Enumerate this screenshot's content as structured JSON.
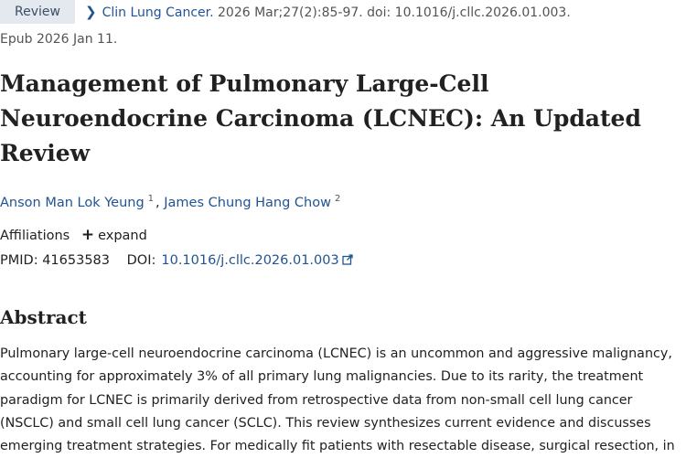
{
  "header": {
    "type_badge": "Review",
    "journal": "Clin Lung Cancer.",
    "citation": "2026 Mar;27(2):85-97. doi: 10.1016/j.cllc.2026.01.003.",
    "epub": "Epub 2026 Jan 11."
  },
  "article": {
    "title_lines": [
      "Management of Pulmonary Large-Cell",
      "Neuroendocrine Carcinoma (LCNEC): An Updated",
      "Review"
    ],
    "authors": [
      {
        "name": "Anson Man Lok Yeung",
        "sup": "1"
      },
      {
        "name": "James Chung Hang Chow",
        "sup": "2"
      }
    ],
    "author_separator": ",",
    "affiliations_label": "Affiliations",
    "expand_label": "expand",
    "pmid_label": "PMID:",
    "pmid": "41653583",
    "doi_label": "DOI:",
    "doi": "10.1016/j.cllc.2026.01.003"
  },
  "abstract": {
    "heading": "Abstract",
    "lines": [
      "Pulmonary large-cell neuroendocrine carcinoma (LCNEC) is an uncommon and aggressive malignancy,",
      "accounting for approximately 3% of all primary lung malignancies. Due to its rarity, the treatment",
      "paradigm for LCNEC is primarily derived from retrospective data from non-small cell lung cancer",
      "(NSCLC) and small cell lung cancer (SCLC). This review synthesizes current evidence and discusses",
      "emerging treatment strategies. For medically fit patients with resectable disease, surgical resection, in"
    ]
  },
  "colors": {
    "link": "#205493",
    "badge_bg": "#e4e9ef",
    "text": "#212121"
  },
  "icons": {
    "breadcrumb": "chevron-right-icon",
    "expand": "plus-icon",
    "doi": "external-link-icon"
  }
}
